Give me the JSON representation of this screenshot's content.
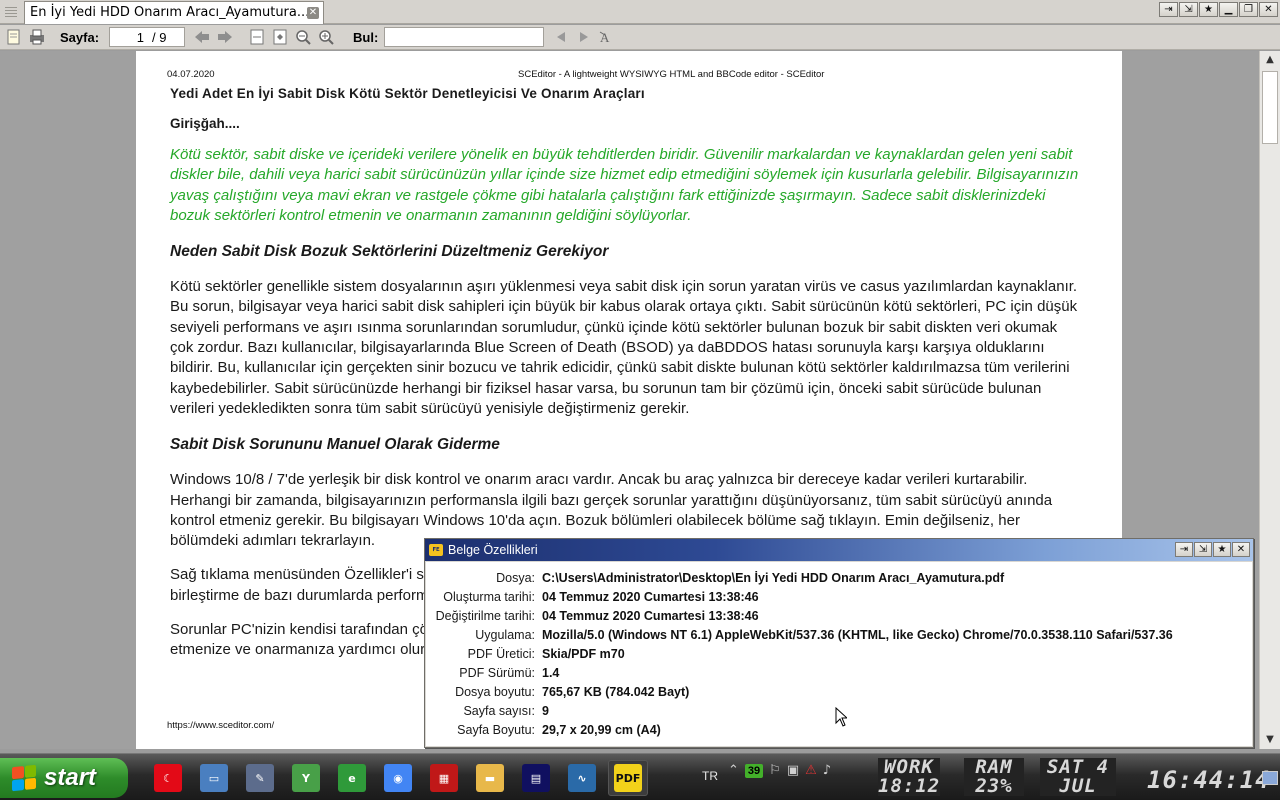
{
  "tab": {
    "title": "En İyi Yedi HDD Onarım Aracı_Ayamutura...",
    "close": "✕"
  },
  "window_buttons": [
    "⇥",
    "⇲",
    "★",
    "▁",
    "❐",
    "✕"
  ],
  "toolbar": {
    "page_label": "Sayfa:",
    "page_current": "1",
    "page_total": "/ 9",
    "find_label": "Bul:",
    "find_value": ""
  },
  "document": {
    "date": "04.07.2020",
    "header": "SCEditor - A lightweight WYSIWYG HTML and BBCode editor - SCEditor",
    "footer": "https://www.sceditor.com/",
    "title": "Yedi Adet En İyi Sabit Disk Kötü Sektör Denetleyicisi Ve Onarım Araçları",
    "intro_heading": "Girişğah....",
    "intro": "Kötü sektör, sabit diske ve içerideki verilere yönelik en büyük tehditlerden biridir. Güvenilir markalardan ve kaynaklardan gelen yeni sabit diskler bile, dahili veya harici sabit sürücünüzün yıllar içinde size hizmet edip etmediğini söylemek için kusurlarla gelebilir. Bilgisayarınızın yavaş çalıştığını veya mavi ekran ve rastgele çökme gibi hatalarla çalıştığını fark ettiğinizde şaşırmayın. Sadece sabit disklerinizdeki bozuk sektörleri kontrol etmenin ve onarmanın zamanının geldiğini söylüyorlar.",
    "h1": "Neden Sabit Disk Bozuk Sektörlerini Düzeltmeniz Gerekiyor",
    "p1": "Kötü sektörler genellikle sistem dosyalarının aşırı yüklenmesi veya sabit disk için sorun yaratan virüs ve casus yazılımlardan kaynaklanır. Bu sorun, bilgisayar veya harici sabit disk sahipleri için büyük bir kabus olarak ortaya çıktı. Sabit sürücünün kötü sektörleri, PC için düşük seviyeli performans ve aşırı ısınma sorunlarından sorumludur, çünkü içinde kötü sektörler bulunan bozuk bir sabit diskten veri okumak çok zordur. Bazı kullanıcılar, bilgisayarlarında Blue Screen of Death (BSOD) ya daBDDOS hatası sorunuyla karşı karşıya olduklarını bildirir. Bu, kullanıcılar için gerçekten sinir bozucu ve tahrik edicidir, çünkü sabit diskte bulunan kötü sektörler kaldırılmazsa tüm verilerini kaybedebilirler. Sabit sürücünüzde herhangi bir fiziksel hasar varsa, bu sorunun tam bir çözümü için, önceki sabit sürücüde bulunan verileri yedekledikten sonra tüm sabit sürücüyü yenisiyle değiştirmeniz gerekir.",
    "h2": "Sabit Disk Sorununu Manuel Olarak Giderme",
    "p2": "Windows 10/8 / 7'de yerleşik bir disk kontrol ve onarım aracı vardır. Ancak bu araç yalnızca bir dereceye kadar verileri kurtarabilir. Herhangi bir zamanda, bilgisayarınızın performansla ilgili bazı gerçek sorunlar yarattığını düşünüyorsanız, tüm sabit sürücüyü anında kontrol etmeniz gerekir. Bu bilgisayarı Windows 10'da açın. Bozuk bölümleri olabilecek bölüme sağ tıklayın. Emin değilseniz, her bölümdeki adımları tekrarlayın.",
    "p3": "Sağ tıklama menüsünden Özellikler'i seçin. Araçlar sekmesine gidin ve Kontrol Et düğmesini tıklayın. Sürücüyü en iyi duruma getirme ve birleştirme de bazı durumlarda performansınızı biraz artırabilir.",
    "p4": "Sorunlar PC'nizin kendisi tarafından çözülemiyorsa, profesyonel bir araç deneyebilirsiniz. Bu araçlar sabit diskinizi etkili bir şekilde kontrol etmenize ve onarmanıza yardımcı olur. Aşağıda, en iyi ücretsiz yazılımla ilgili bir sorun olabilir."
  },
  "properties": {
    "title": "Belge Özellikleri",
    "badge": "ꜰᴇ",
    "rows": [
      {
        "key": "Dosya:",
        "value": "C:\\Users\\Administrator\\Desktop\\En İyi Yedi HDD Onarım Aracı_Ayamutura.pdf"
      },
      {
        "key": "Oluşturma tarihi:",
        "value": "04 Temmuz 2020 Cumartesi 13:38:46"
      },
      {
        "key": "Değiştirilme tarihi:",
        "value": "04 Temmuz 2020 Cumartesi 13:38:46"
      },
      {
        "key": "Uygulama:",
        "value": "Mozilla/5.0 (Windows NT 6.1) AppleWebKit/537.36 (KHTML, like Gecko) Chrome/70.0.3538.110 Safari/537.36"
      },
      {
        "key": "PDF Üretici:",
        "value": "Skia/PDF m70"
      },
      {
        "key": "PDF Sürümü:",
        "value": "1.4"
      },
      {
        "key": "Dosya boyutu:",
        "value": "765,67 KB (784.042 Bayt)"
      },
      {
        "key": "Sayfa sayısı:",
        "value": "9"
      },
      {
        "key": "Sayfa Boyutu:",
        "value": "29,7 x 20,99 cm (A4)"
      }
    ],
    "buttons": [
      "⇥",
      "⇲",
      "★",
      "✕"
    ]
  },
  "taskbar": {
    "start": "start",
    "lang": "TR",
    "tray_badge": "39",
    "work_l1": "WORK",
    "work_l2": "18:12",
    "ram_l1": "RAM",
    "ram_l2": "23%",
    "date_l1": "SAT 4",
    "date_l2": "JUL",
    "clock": "16:44:14",
    "apps": [
      {
        "name": "turkey-flag",
        "color": "#e30a17",
        "glyph": "☾"
      },
      {
        "name": "computer",
        "color": "#4a7fc0",
        "glyph": "▭"
      },
      {
        "name": "tools",
        "color": "#5c6c8c",
        "glyph": "✎"
      },
      {
        "name": "utility",
        "color": "#48a048",
        "glyph": "Y"
      },
      {
        "name": "browser-green",
        "color": "#2f9a3a",
        "glyph": "e"
      },
      {
        "name": "chrome",
        "color": "#4285f4",
        "glyph": "◉"
      },
      {
        "name": "chip",
        "color": "#c01818",
        "glyph": "▦"
      },
      {
        "name": "folder",
        "color": "#e8b84a",
        "glyph": "▬"
      },
      {
        "name": "terminal",
        "color": "#101060",
        "glyph": "▤"
      },
      {
        "name": "monitor",
        "color": "#2a6aa8",
        "glyph": "∿"
      },
      {
        "name": "pdf",
        "color": "#f2d21a",
        "glyph": "PDF"
      }
    ]
  }
}
